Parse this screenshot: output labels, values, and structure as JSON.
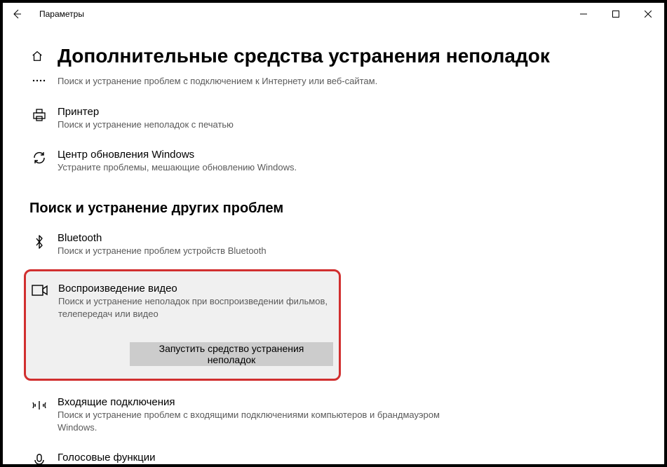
{
  "window_title": "Параметры",
  "page_title": "Дополнительные средства устранения неполадок",
  "items": {
    "internet_desc": "Поиск и устранение проблем с подключением к Интернету или веб-сайтам.",
    "printer_title": "Принтер",
    "printer_desc": "Поиск и устранение неполадок с печатью",
    "wu_title": "Центр обновления Windows",
    "wu_desc": "Устраните проблемы, мешающие обновлению Windows."
  },
  "section2_heading": "Поиск и устранение других проблем",
  "items2": {
    "bt_title": "Bluetooth",
    "bt_desc": "Поиск и устранение проблем устройств Bluetooth",
    "video_title": "Воспроизведение видео",
    "video_desc": "Поиск и устранение неполадок при воспроизведении фильмов, телепередач или видео",
    "run_button": "Запустить средство устранения неполадок",
    "incoming_title": "Входящие подключения",
    "incoming_desc": "Поиск и устранение проблем с входящими подключениями компьютеров и брандмауэром Windows.",
    "voice_title": "Голосовые функции"
  }
}
